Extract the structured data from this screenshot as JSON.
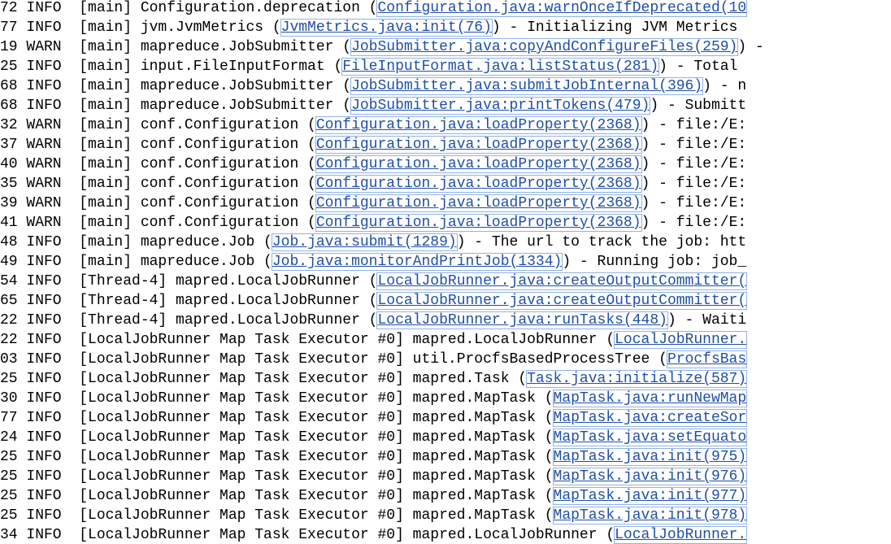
{
  "console": {
    "lines": [
      {
        "prefix": "72 INFO  [main] Configuration.deprecation (",
        "link": "Configuration.java:warnOnceIfDeprecated(10",
        "suffix": ""
      },
      {
        "prefix": "77 INFO  [main] jvm.JvmMetrics (",
        "link": "JvmMetrics.java:init(76)",
        "suffix": ") - Initializing JVM Metrics"
      },
      {
        "prefix": "19 WARN  [main] mapreduce.JobSubmitter (",
        "link": "JobSubmitter.java:copyAndConfigureFiles(259)",
        "suffix": ") -"
      },
      {
        "prefix": "25 INFO  [main] input.FileInputFormat (",
        "link": "FileInputFormat.java:listStatus(281)",
        "suffix": ") - Total"
      },
      {
        "prefix": "68 INFO  [main] mapreduce.JobSubmitter (",
        "link": "JobSubmitter.java:submitJobInternal(396)",
        "suffix": ") - n"
      },
      {
        "prefix": "68 INFO  [main] mapreduce.JobSubmitter (",
        "link": "JobSubmitter.java:printTokens(479)",
        "suffix": ") - Submitt"
      },
      {
        "prefix": "32 WARN  [main] conf.Configuration (",
        "link": "Configuration.java:loadProperty(2368)",
        "suffix": ") - file:/E:"
      },
      {
        "prefix": "37 WARN  [main] conf.Configuration (",
        "link": "Configuration.java:loadProperty(2368)",
        "suffix": ") - file:/E:"
      },
      {
        "prefix": "40 WARN  [main] conf.Configuration (",
        "link": "Configuration.java:loadProperty(2368)",
        "suffix": ") - file:/E:"
      },
      {
        "prefix": "35 WARN  [main] conf.Configuration (",
        "link": "Configuration.java:loadProperty(2368)",
        "suffix": ") - file:/E:"
      },
      {
        "prefix": "39 WARN  [main] conf.Configuration (",
        "link": "Configuration.java:loadProperty(2368)",
        "suffix": ") - file:/E:"
      },
      {
        "prefix": "41 WARN  [main] conf.Configuration (",
        "link": "Configuration.java:loadProperty(2368)",
        "suffix": ") - file:/E:"
      },
      {
        "prefix": "48 INFO  [main] mapreduce.Job (",
        "link": "Job.java:submit(1289)",
        "suffix": ") - The url to track the job: htt"
      },
      {
        "prefix": "49 INFO  [main] mapreduce.Job (",
        "link": "Job.java:monitorAndPrintJob(1334)",
        "suffix": ") - Running job: job_"
      },
      {
        "prefix": "54 INFO  [Thread-4] mapred.LocalJobRunner (",
        "link": "LocalJobRunner.java:createOutputCommitter(",
        "suffix": ""
      },
      {
        "prefix": "65 INFO  [Thread-4] mapred.LocalJobRunner (",
        "link": "LocalJobRunner.java:createOutputCommitter(",
        "suffix": ""
      },
      {
        "prefix": "22 INFO  [Thread-4] mapred.LocalJobRunner (",
        "link": "LocalJobRunner.java:runTasks(448)",
        "suffix": ") - Waiti"
      },
      {
        "prefix": "22 INFO  [LocalJobRunner Map Task Executor #0] mapred.LocalJobRunner (",
        "link": "LocalJobRunner.",
        "suffix": ""
      },
      {
        "prefix": "03 INFO  [LocalJobRunner Map Task Executor #0] util.ProcfsBasedProcessTree (",
        "link": "ProcfsBas",
        "suffix": ""
      },
      {
        "prefix": "25 INFO  [LocalJobRunner Map Task Executor #0] mapred.Task (",
        "link": "Task.java:initialize(587)",
        "suffix": ""
      },
      {
        "prefix": "30 INFO  [LocalJobRunner Map Task Executor #0] mapred.MapTask (",
        "link": "MapTask.java:runNewMap",
        "suffix": ""
      },
      {
        "prefix": "77 INFO  [LocalJobRunner Map Task Executor #0] mapred.MapTask (",
        "link": "MapTask.java:createSor",
        "suffix": ""
      },
      {
        "prefix": "24 INFO  [LocalJobRunner Map Task Executor #0] mapred.MapTask (",
        "link": "MapTask.java:setEquato",
        "suffix": ""
      },
      {
        "prefix": "25 INFO  [LocalJobRunner Map Task Executor #0] mapred.MapTask (",
        "link": "MapTask.java:init(975)",
        "suffix": ""
      },
      {
        "prefix": "25 INFO  [LocalJobRunner Map Task Executor #0] mapred.MapTask (",
        "link": "MapTask.java:init(976)",
        "suffix": ""
      },
      {
        "prefix": "25 INFO  [LocalJobRunner Map Task Executor #0] mapred.MapTask (",
        "link": "MapTask.java:init(977)",
        "suffix": ""
      },
      {
        "prefix": "25 INFO  [LocalJobRunner Map Task Executor #0] mapred.MapTask (",
        "link": "MapTask.java:init(978)",
        "suffix": ""
      },
      {
        "prefix": "34 INFO  [LocalJobRunner Map Task Executor #0] mapred.LocalJobRunner (",
        "link": "LocalJobRunner.",
        "suffix": ""
      }
    ]
  }
}
